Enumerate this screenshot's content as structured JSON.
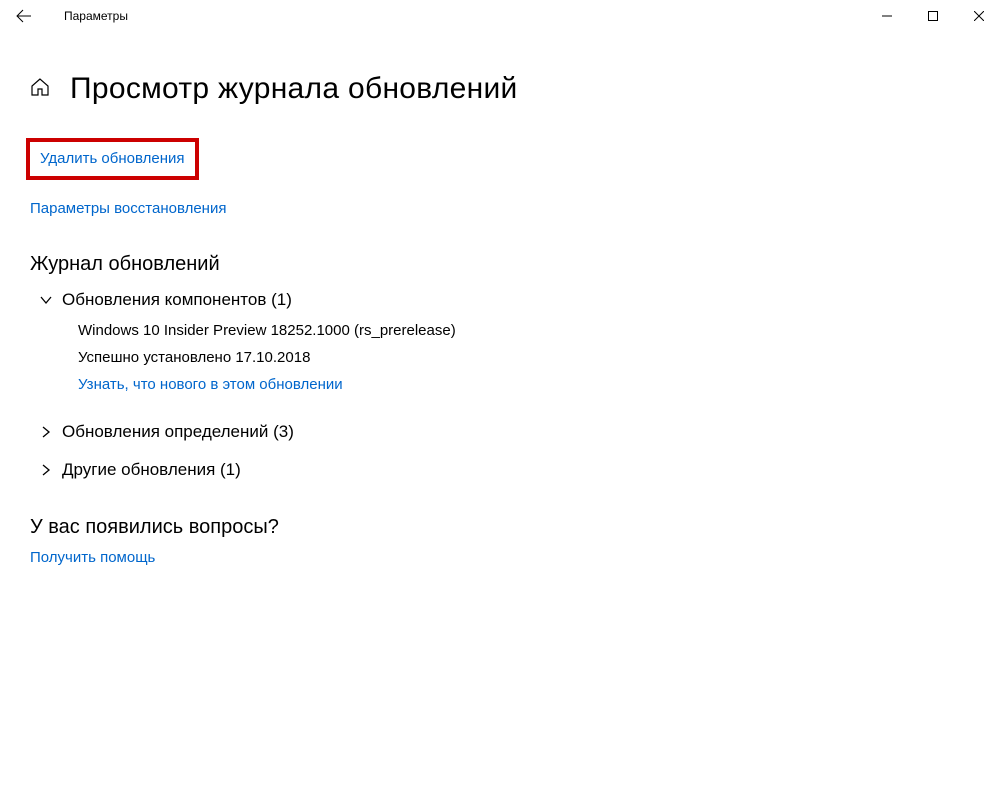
{
  "window": {
    "title": "Параметры"
  },
  "page": {
    "title": "Просмотр журнала обновлений"
  },
  "links": {
    "uninstall_updates": "Удалить обновления",
    "recovery_options": "Параметры восстановления",
    "learn_more": "Узнать, что нового в этом обновлении",
    "get_help": "Получить помощь"
  },
  "sections": {
    "history_heading": "Журнал обновлений",
    "feature_updates": "Обновления компонентов (1)",
    "definition_updates": "Обновления определений (3)",
    "other_updates": "Другие обновления (1)",
    "questions_heading": "У вас появились вопросы?"
  },
  "update_entry": {
    "name": "Windows 10 Insider Preview 18252.1000 (rs_prerelease)",
    "status": "Успешно установлено 17.10.2018"
  }
}
